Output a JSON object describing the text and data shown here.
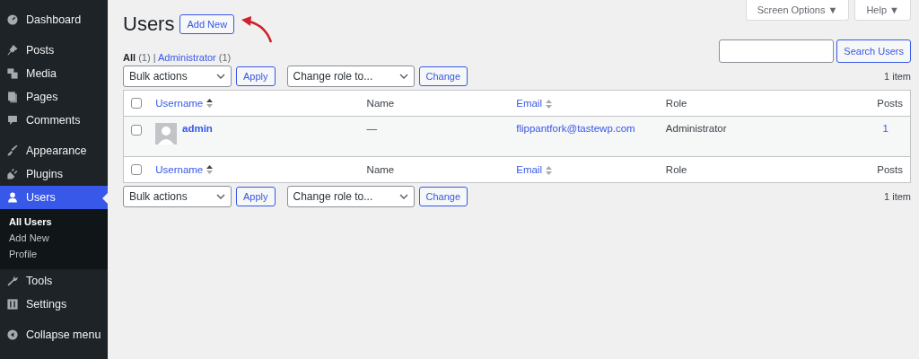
{
  "sidebar": {
    "groups": [
      [
        {
          "label": "Dashboard",
          "selected": false
        }
      ],
      [
        {
          "label": "Posts",
          "selected": false
        },
        {
          "label": "Media",
          "selected": false
        },
        {
          "label": "Pages",
          "selected": false
        },
        {
          "label": "Comments",
          "selected": false
        }
      ],
      [
        {
          "label": "Appearance",
          "selected": false
        },
        {
          "label": "Plugins",
          "selected": false
        },
        {
          "label": "Users",
          "selected": true,
          "children": [
            {
              "label": "All Users",
              "selected": true
            },
            {
              "label": "Add New",
              "selected": false
            },
            {
              "label": "Profile",
              "selected": false
            }
          ]
        },
        {
          "label": "Tools",
          "selected": false
        },
        {
          "label": "Settings",
          "selected": false
        }
      ]
    ],
    "collapse": "Collapse menu"
  },
  "top_buttons": [
    "Screen Options ▼",
    "Help ▼"
  ],
  "page_title": "Users",
  "add_new": "Add New",
  "filter_separator": "|",
  "filters": [
    {
      "label": "All",
      "count": "(1)",
      "selected": true
    },
    {
      "label": "Administrator",
      "count": "(1)",
      "selected": false
    }
  ],
  "search": {
    "button": "Search Users"
  },
  "tablenav_top": {
    "bulk": "Bulk actions",
    "apply": "Apply",
    "role": "Change role to...",
    "change": "Change",
    "count": "1 item"
  },
  "table": {
    "select_all_checked": false,
    "footer_select_all_checked": false,
    "columns": [
      {
        "label": "Username",
        "sortable": true,
        "sorted": true
      },
      {
        "label": "Name",
        "sortable": false
      },
      {
        "label": "Email",
        "sortable": true,
        "sorted": false
      },
      {
        "label": "Role",
        "sortable": false
      },
      {
        "label": "Posts",
        "sortable": false
      }
    ],
    "rows": [
      {
        "checked": false,
        "username": "admin",
        "name": "—",
        "email": "flippantfork@tastewp.com",
        "role": "Administrator",
        "posts": "1"
      }
    ],
    "footer": [
      {
        "label": "Username",
        "sortable": true,
        "sorted": true
      },
      {
        "label": "Name",
        "sortable": false
      },
      {
        "label": "Email",
        "sortable": true,
        "sorted": false
      },
      {
        "label": "Role",
        "sortable": false
      },
      {
        "label": "Posts",
        "sortable": false
      }
    ]
  },
  "tablenav_bottom": {
    "bulk": "Bulk actions",
    "apply": "Apply",
    "role": "Change role to...",
    "change": "Change",
    "count": "1 item"
  }
}
